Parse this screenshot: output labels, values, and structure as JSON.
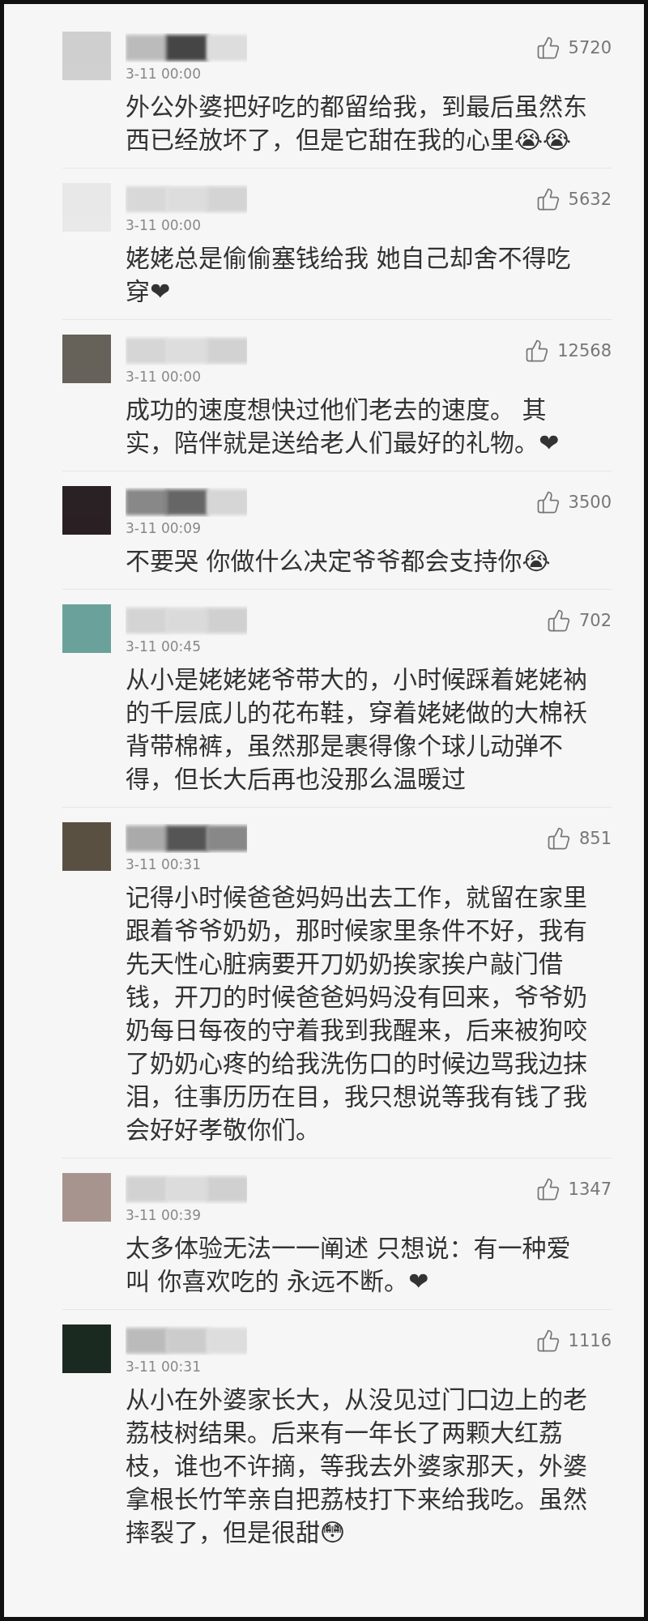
{
  "comments": [
    {
      "likes": "5720",
      "time": "3-11 00:00",
      "text": "外公外婆把好吃的都留给我，到最后虽然东西已经放坏了，但是它甜在我的心里😭😭"
    },
    {
      "likes": "5632",
      "time": "3-11 00:00",
      "text": "姥姥总是偷偷塞钱给我 她自己却舍不得吃穿❤"
    },
    {
      "likes": "12568",
      "time": "3-11 00:00",
      "text": "成功的速度想快过他们老去的速度。 其实，陪伴就是送给老人们最好的礼物。❤"
    },
    {
      "likes": "3500",
      "time": "3-11 00:09",
      "text": "不要哭 你做什么决定爷爷都会支持你😭"
    },
    {
      "likes": "702",
      "time": "3-11 00:45",
      "text": "从小是姥姥姥爷带大的，小时候踩着姥姥衲的千层底儿的花布鞋，穿着姥姥做的大棉袄背带棉裤，虽然那是裹得像个球儿动弹不得，但长大后再也没那么温暖过"
    },
    {
      "likes": "851",
      "time": "3-11 00:31",
      "text": "记得小时候爸爸妈妈出去工作，就留在家里跟着爷爷奶奶，那时候家里条件不好，我有先天性心脏病要开刀奶奶挨家挨户敲门借钱，开刀的时候爸爸妈妈没有回来，爷爷奶奶每日每夜的守着我到我醒来，后来被狗咬了奶奶心疼的给我洗伤口的时候边骂我边抹泪，往事历历在目，我只想说等我有钱了我会好好孝敬你们。"
    },
    {
      "likes": "1347",
      "time": "3-11 00:39",
      "text": "太多体验无法一一阐述 只想说：有一种爱叫 你喜欢吃的 永远不断。❤"
    },
    {
      "likes": "1116",
      "time": "3-11 00:31",
      "text": "从小在外婆家长大，从没见过门口边上的老荔枝树结果。后来有一年长了两颗大红荔枝，谁也不许摘，等我去外婆家那天，外婆拿根长竹竿亲自把荔枝打下来给我吃。虽然摔裂了，但是很甜😳"
    }
  ]
}
